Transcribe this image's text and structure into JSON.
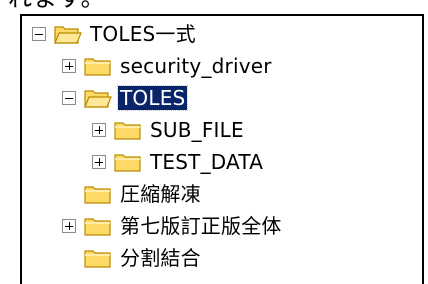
{
  "page": {
    "top_fragment": "れます。"
  },
  "tree": {
    "colors": {
      "selection_bg": "#0a246a",
      "selection_fg": "#ffffff",
      "folder_fill": "#ffd966",
      "folder_edge": "#b88a00"
    },
    "items": [
      {
        "label": "TOLES一式",
        "toggle": "minus",
        "icon": "folder-open-icon",
        "selected": false
      },
      {
        "label": "security_driver",
        "toggle": "plus",
        "icon": "folder-icon",
        "selected": false
      },
      {
        "label": "TOLES",
        "toggle": "minus",
        "icon": "folder-open-icon",
        "selected": true
      },
      {
        "label": "SUB_FILE",
        "toggle": "plus",
        "icon": "folder-icon",
        "selected": false
      },
      {
        "label": "TEST_DATA",
        "toggle": "plus",
        "icon": "folder-icon",
        "selected": false
      },
      {
        "label": "圧縮解凍",
        "toggle": "none",
        "icon": "folder-icon",
        "selected": false
      },
      {
        "label": "第七版訂正版全体",
        "toggle": "plus",
        "icon": "folder-icon",
        "selected": false
      },
      {
        "label": "分割結合",
        "toggle": "none",
        "icon": "folder-icon",
        "selected": false
      }
    ]
  }
}
